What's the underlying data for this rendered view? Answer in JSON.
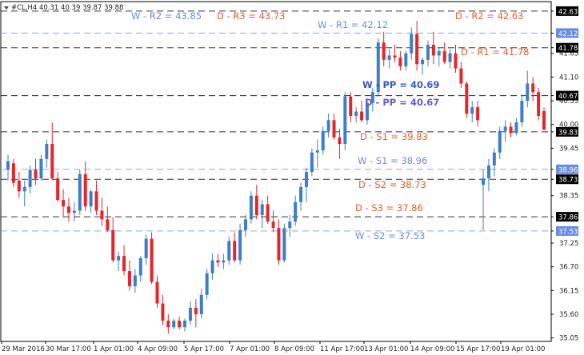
{
  "symbol_line": "#CL,H4  40.31 40.39 39.87 39.88",
  "chart_data": {
    "type": "candlestick",
    "symbol": "#CL,H4",
    "timeframe": "H4",
    "ohlc_header": {
      "open": 40.31,
      "high": 40.39,
      "low": 39.87,
      "close": 39.88
    },
    "ylim": [
      34.97,
      42.85
    ],
    "y_ticks": [
      "42.63",
      "42.12",
      "41.78",
      "41.65",
      "41.10",
      "40.67",
      "40.55",
      "40.00",
      "39.83",
      "39.45",
      "38.96",
      "38.73",
      "38.35",
      "37.86",
      "37.53",
      "37.25",
      "36.70",
      "36.15",
      "35.60",
      "35.05"
    ],
    "x_ticks": [
      "29 Mar 2016",
      "30 Mar 17:00",
      "1 Apr 01:00",
      "4 Apr 09:00",
      "5 Apr 17:00",
      "7 Apr 01:00",
      "8 Apr 09:00",
      "11 Apr 17:00",
      "13 Apr 01:00",
      "14 Apr 09:00",
      "15 Apr 17:00",
      "19 Apr 01:00"
    ],
    "price_tags": [
      {
        "value": 42.63,
        "text": "42.63",
        "style": "black"
      },
      {
        "value": 42.12,
        "text": "42.12",
        "style": "blue"
      },
      {
        "value": 41.78,
        "text": "41.78",
        "style": "black"
      },
      {
        "value": 40.67,
        "text": "40.67",
        "style": "black"
      },
      {
        "value": 39.83,
        "text": "39.83",
        "style": "black"
      },
      {
        "value": 38.96,
        "text": "38.96",
        "style": "blue"
      },
      {
        "value": 38.73,
        "text": "38.73",
        "style": "black"
      },
      {
        "value": 37.86,
        "text": "37.86",
        "style": "black"
      },
      {
        "value": 37.53,
        "text": "37.53",
        "style": "blue"
      }
    ],
    "levels": [
      {
        "id": "w-r2",
        "label": "W - R2 = 43.85",
        "color": "#6b8be0",
        "bold": false
      },
      {
        "id": "d-r3",
        "label": "D - R3 = 43.73",
        "color": "#f05a2c",
        "bold": false
      },
      {
        "id": "w-r1",
        "label": "W - R1 = 42.12",
        "value": 42.12,
        "color": "#6b8be0",
        "line": "#8fa8e8",
        "bold": false
      },
      {
        "id": "d-r2",
        "label": "D - R2 = 42.63",
        "value": 42.63,
        "color": "#f05a2c",
        "line": "#333333",
        "bold": false
      },
      {
        "id": "d-r1",
        "label": "D - R1 = 41.78",
        "value": 41.78,
        "color": "#f05a2c",
        "line": "#333333",
        "bold": false
      },
      {
        "id": "w-pp",
        "label": "W - PP = 40.69",
        "color": "#3a56c8",
        "bold": true
      },
      {
        "id": "d-pp",
        "label": "D - PP = 40.67",
        "value": 40.67,
        "color": "#6a5acd",
        "line": "#222222",
        "bold": true
      },
      {
        "id": "d-s1",
        "label": "D - S1 = 39.83",
        "value": 39.83,
        "color": "#f05a2c",
        "line": "#333333",
        "bold": false
      },
      {
        "id": "w-s1",
        "label": "W - S1 = 38.96",
        "value": 38.96,
        "color": "#6b8be0",
        "line": "#8fa8e8",
        "bold": false
      },
      {
        "id": "d-s2",
        "label": "D - S2 = 38.73",
        "value": 38.73,
        "color": "#f05a2c",
        "line": "#333333",
        "bold": false
      },
      {
        "id": "d-s3",
        "label": "D - S3 = 37.86",
        "value": 37.86,
        "color": "#f05a2c",
        "line": "#333333",
        "bold": false
      },
      {
        "id": "w-s2",
        "label": "W - S2 = 37.53",
        "value": 37.53,
        "color": "#6b8be0",
        "line": "#8fa8e8",
        "bold": false
      }
    ],
    "colors": {
      "up": "#3d7fc4",
      "down": "#e8242a",
      "grid": "#c8c8c8"
    },
    "candles": [
      [
        38.95,
        39.3,
        38.7,
        39.15
      ],
      [
        39.1,
        39.2,
        38.55,
        38.65
      ],
      [
        38.7,
        38.9,
        38.3,
        38.45
      ],
      [
        38.45,
        38.7,
        38.1,
        38.55
      ],
      [
        38.55,
        39.05,
        38.4,
        38.95
      ],
      [
        38.95,
        39.2,
        38.6,
        38.75
      ],
      [
        38.75,
        39.3,
        38.7,
        39.2
      ],
      [
        39.2,
        39.65,
        39.0,
        39.55
      ],
      [
        39.55,
        40.05,
        38.7,
        38.75
      ],
      [
        38.75,
        38.9,
        38.2,
        38.25
      ],
      [
        38.25,
        38.5,
        37.85,
        38.1
      ],
      [
        38.1,
        38.3,
        37.75,
        37.95
      ],
      [
        37.95,
        38.2,
        37.75,
        38.0
      ],
      [
        38.0,
        38.95,
        37.9,
        38.85
      ],
      [
        38.85,
        39.15,
        38.0,
        38.1
      ],
      [
        38.1,
        38.5,
        37.95,
        38.45
      ],
      [
        38.45,
        38.7,
        37.9,
        38.0
      ],
      [
        38.0,
        38.3,
        37.65,
        37.8
      ],
      [
        37.8,
        38.1,
        37.5,
        37.55
      ],
      [
        37.55,
        37.85,
        36.8,
        36.85
      ],
      [
        36.85,
        37.05,
        36.6,
        36.95
      ],
      [
        36.95,
        37.2,
        36.5,
        36.6
      ],
      [
        36.6,
        36.85,
        36.15,
        36.25
      ],
      [
        36.25,
        36.65,
        36.1,
        36.5
      ],
      [
        36.5,
        36.95,
        36.35,
        36.9
      ],
      [
        36.9,
        37.45,
        36.75,
        37.35
      ],
      [
        37.35,
        37.5,
        36.3,
        36.35
      ],
      [
        36.35,
        36.5,
        35.75,
        35.85
      ],
      [
        35.85,
        36.05,
        35.35,
        35.45
      ],
      [
        35.45,
        35.6,
        35.15,
        35.3
      ],
      [
        35.3,
        35.5,
        35.25,
        35.45
      ],
      [
        35.45,
        35.55,
        35.25,
        35.3
      ],
      [
        35.3,
        35.5,
        35.2,
        35.45
      ],
      [
        35.45,
        35.9,
        35.35,
        35.75
      ],
      [
        35.75,
        35.95,
        35.3,
        35.6
      ],
      [
        35.6,
        36.2,
        35.5,
        36.05
      ],
      [
        36.05,
        36.65,
        35.95,
        36.55
      ],
      [
        36.55,
        37.0,
        36.4,
        36.85
      ],
      [
        36.85,
        37.0,
        36.7,
        36.8
      ],
      [
        36.8,
        37.0,
        36.65,
        36.85
      ],
      [
        36.85,
        37.4,
        36.75,
        37.3
      ],
      [
        37.3,
        37.5,
        36.8,
        36.85
      ],
      [
        36.85,
        37.7,
        36.75,
        37.55
      ],
      [
        37.55,
        37.9,
        37.4,
        37.8
      ],
      [
        37.8,
        38.45,
        37.7,
        38.35
      ],
      [
        38.35,
        38.6,
        37.8,
        37.9
      ],
      [
        37.9,
        38.25,
        37.6,
        38.15
      ],
      [
        38.15,
        38.35,
        37.7,
        37.75
      ],
      [
        37.75,
        38.0,
        37.5,
        37.6
      ],
      [
        37.6,
        37.8,
        36.75,
        36.85
      ],
      [
        36.85,
        37.7,
        36.8,
        37.6
      ],
      [
        37.6,
        37.9,
        37.4,
        37.75
      ],
      [
        37.75,
        38.35,
        37.65,
        38.2
      ],
      [
        38.2,
        38.65,
        38.0,
        38.55
      ],
      [
        38.55,
        39.0,
        38.2,
        38.9
      ],
      [
        38.9,
        39.45,
        38.8,
        39.35
      ],
      [
        39.35,
        39.65,
        39.0,
        39.4
      ],
      [
        39.4,
        39.95,
        39.3,
        39.85
      ],
      [
        39.85,
        40.25,
        39.7,
        40.1
      ],
      [
        40.1,
        40.25,
        39.65,
        39.7
      ],
      [
        39.7,
        39.9,
        39.2,
        39.55
      ],
      [
        39.55,
        40.75,
        39.4,
        40.65
      ],
      [
        40.65,
        40.75,
        40.05,
        40.2
      ],
      [
        40.2,
        40.4,
        40.05,
        40.3
      ],
      [
        40.3,
        40.55,
        40.05,
        40.1
      ],
      [
        40.1,
        40.6,
        40.0,
        40.5
      ],
      [
        40.5,
        40.85,
        40.3,
        40.75
      ],
      [
        40.75,
        42.0,
        40.65,
        41.9
      ],
      [
        41.9,
        42.15,
        41.35,
        41.5
      ],
      [
        41.5,
        41.75,
        41.3,
        41.6
      ],
      [
        41.6,
        41.85,
        41.45,
        41.55
      ],
      [
        41.55,
        41.7,
        41.25,
        41.35
      ],
      [
        41.35,
        41.7,
        41.25,
        41.65
      ],
      [
        41.65,
        42.25,
        41.5,
        42.1
      ],
      [
        42.1,
        42.4,
        41.25,
        41.4
      ],
      [
        41.4,
        41.55,
        41.15,
        41.5
      ],
      [
        41.5,
        41.95,
        41.35,
        41.85
      ],
      [
        41.85,
        42.15,
        41.4,
        41.6
      ],
      [
        41.6,
        41.8,
        41.35,
        41.7
      ],
      [
        41.7,
        41.9,
        41.4,
        41.45
      ],
      [
        41.45,
        41.75,
        41.3,
        41.65
      ],
      [
        41.65,
        41.85,
        41.2,
        41.3
      ],
      [
        41.3,
        41.45,
        40.85,
        40.95
      ],
      [
        40.95,
        41.0,
        40.15,
        40.25
      ],
      [
        40.25,
        40.55,
        40.05,
        40.4
      ],
      [
        40.4,
        40.55,
        39.95,
        40.1
      ],
      [
        38.6,
        38.95,
        37.55,
        38.75
      ],
      [
        38.75,
        39.2,
        38.45,
        39.05
      ],
      [
        39.05,
        39.45,
        38.8,
        39.35
      ],
      [
        39.35,
        39.95,
        39.2,
        39.85
      ],
      [
        39.85,
        40.1,
        39.6,
        39.95
      ],
      [
        39.95,
        40.05,
        39.7,
        39.8
      ],
      [
        39.8,
        40.15,
        39.75,
        40.05
      ],
      [
        40.05,
        40.7,
        39.95,
        40.55
      ],
      [
        40.55,
        41.25,
        40.4,
        40.95
      ],
      [
        40.95,
        41.1,
        40.55,
        40.75
      ],
      [
        40.75,
        40.85,
        40.1,
        40.2
      ],
      [
        40.31,
        40.39,
        39.87,
        39.88
      ]
    ]
  }
}
